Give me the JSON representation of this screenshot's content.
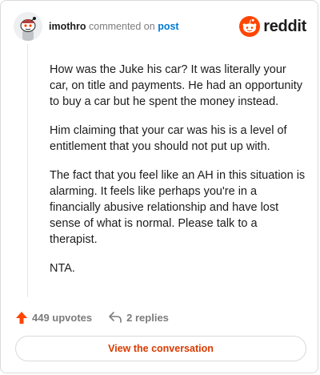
{
  "header": {
    "username": "imothro",
    "verb": "commented on",
    "link_text": "post",
    "brand": "reddit"
  },
  "comment": {
    "paragraphs": [
      "How was the Juke his car? It was literally your car, on title and payments. He had an opportunity to buy a car but he spent the money instead.",
      "Him claiming that your car was his is a level of entitlement that you should not put up with.",
      "The fact that you feel like an AH in this situation is alarming. It feels like perhaps you're in a financially abusive relationship and have lost sense of what is normal. Please talk to a therapist.",
      "NTA."
    ]
  },
  "actions": {
    "upvotes_label": "449 upvotes",
    "replies_label": "2 replies",
    "upvote_icon": "upvote-arrow-icon",
    "reply_icon": "reply-arrow-icon"
  },
  "cta": {
    "label": "View the conversation"
  },
  "colors": {
    "brand_orange": "#ff4500",
    "link_blue": "#0079d3",
    "cta_text": "#d93a00",
    "muted_text": "#7c7c7c"
  }
}
